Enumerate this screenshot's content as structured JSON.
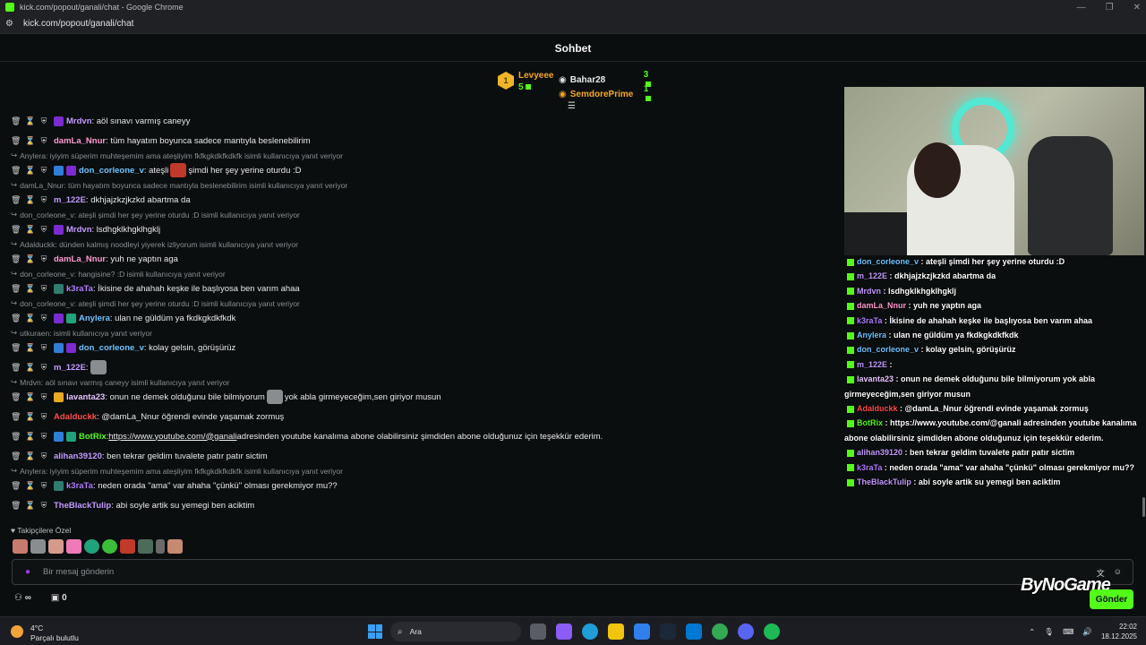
{
  "browser": {
    "window_title": "kick.com/popout/ganali/chat - Google Chrome",
    "url": "kick.com/popout/ganali/chat"
  },
  "chat": {
    "header_title": "Sohbet",
    "leaderboard": {
      "first": {
        "name": "Levyeee",
        "count": "5",
        "rank": "1"
      },
      "rows": [
        {
          "name": "Bahar28",
          "count": "3"
        },
        {
          "name": "SemdorePrime",
          "count": "1"
        }
      ]
    },
    "messages": [
      {
        "reply": "",
        "user": "Mrdvn",
        "color": "#c39bff",
        "badges": [
          "#7b2bd1"
        ],
        "text": ": aöl sınavı varmış caneyy"
      },
      {
        "reply": "",
        "user": "damLa_Nnur",
        "color": "#ff9ad0",
        "badges": [],
        "text": ": tüm hayatım boyunca sadece mantıyla beslenebilirim"
      },
      {
        "reply": "Anylera: iyiyim süperim muhteşemim ama ateşliyim fkfkgkdkfkdkfk isimli kullanıcıya yanıt veriyor",
        "user": "don_corleone_v",
        "color": "#6ec3ff",
        "badges": [
          "#2f7fd8",
          "#7b2bd1"
        ],
        "text": ": ateşli",
        "emote": "#c0392b",
        "after": "şimdi her şey yerine oturdu :D"
      },
      {
        "reply": "damLa_Nnur: tüm hayatım boyunca sadece mantıyla beslenebilirim isimli kullanıcıya yanıt veriyor",
        "user": "m_122E",
        "color": "#c39bff",
        "badges": [],
        "text": ": dkhjajzkzjkzkd abartma da"
      },
      {
        "reply": "don_corleone_v: ateşli şimdi her şey yerine oturdu :D isimli kullanıcıya yanıt veriyor",
        "user": "Mrdvn",
        "color": "#c39bff",
        "badges": [
          "#7b2bd1"
        ],
        "text": ": lsdhgklkhgklhgklj"
      },
      {
        "reply": "Adalduckk: dünden kalmış noodleyi yiyerek izliyorum isimli kullanıcıya yanıt veriyor",
        "user": "damLa_Nnur",
        "color": "#ff9ad0",
        "badges": [],
        "text": ": yuh ne yaptın aga"
      },
      {
        "reply": "don_corleone_v: hangisine? :D isimli kullanıcıya yanıt veriyor",
        "user": "k3raTa",
        "color": "#b07cff",
        "badges": [
          "#2e7d6e"
        ],
        "text": ": İkisine de ahahah keşke ile başlıyosa ben varım ahaa"
      },
      {
        "reply": "don_corleone_v: ateşli şimdi her şey yerine oturdu :D isimli kullanıcıya yanıt veriyor",
        "user": "Anylera",
        "color": "#6ec3ff",
        "badges": [
          "#7b2bd1",
          "#1fa37a"
        ],
        "text": ": ulan ne güldüm ya fkdkgkdkfkdk"
      },
      {
        "reply": "utkuraen: isimli kullanıcıya yanıt veriyor",
        "user": "don_corleone_v",
        "color": "#6ec3ff",
        "badges": [
          "#2f7fd8",
          "#7b2bd1"
        ],
        "text": ": kolay gelsin, görüşürüz"
      },
      {
        "reply": "",
        "user": "m_122E",
        "color": "#c39bff",
        "badges": [],
        "text": ":",
        "emote": "#8a8d90"
      },
      {
        "reply": "Mrdvn: aöl sınavı varmış caneyy isimli kullanıcıya yanıt veriyor",
        "user": "lavanta23",
        "color": "#e7c3ff",
        "badges": [
          "#e8a923"
        ],
        "text": ": onun ne demek olduğunu bile bilmiyorum",
        "emote": "#8a8d90",
        "after": "yok abla girmeyeceğim,sen giriyor musun"
      },
      {
        "reply": "",
        "user": "Adalduckk",
        "color": "#ff4d4d",
        "badges": [],
        "text": ": @damLa_Nnur öğrendi evinde yaşamak zormuş"
      },
      {
        "reply": "",
        "user": "BotRix",
        "color": "#53fc18",
        "badges": [
          "#2f7fd8",
          "#1fa37a"
        ],
        "text": ": ",
        "link": "https://www.youtube.com/@ganali",
        "after": " adresinden youtube kanalıma abone olabilirsiniz şimdiden abone olduğunuz için teşekkür ederim."
      },
      {
        "reply": "",
        "user": "alihan39120",
        "color": "#c39bff",
        "badges": [],
        "text": ": ben tekrar geldim tuvalete patır patır sictim"
      },
      {
        "reply": "Anylera: iyiyim süperim muhteşemim ama ateşliyim fkfkgkdkfkdkfk isimli kullanıcıya yanıt veriyor",
        "user": "k3raTa",
        "color": "#b07cff",
        "badges": [
          "#2e7d6e"
        ],
        "text": ": neden orada \"ama\" var ahaha \"çünkü\" olması gerekmiyor mu??"
      },
      {
        "reply": "",
        "user": "TheBlackTulip",
        "color": "#c39bff",
        "badges": [],
        "text": ": abi soyle artik su yemegi ben aciktim"
      }
    ],
    "followers_label": "Takipçilere Özel",
    "input_placeholder": "Bir mesaj gönderin",
    "bottom_count": "0",
    "send_label": "Gönder"
  },
  "overlay": {
    "brand": "ByNoGame",
    "lines": [
      {
        "user": "don_corleone_v",
        "color": "#6ec3ff",
        "text": " : ateşli  şimdi her şey yerine oturdu :D"
      },
      {
        "user": "m_122E",
        "color": "#c39bff",
        "text": " : dkhjajzkzjkzkd abartma da"
      },
      {
        "user": "Mrdvn",
        "color": "#c39bff",
        "text": " : lsdhgklkhgklhgklj"
      },
      {
        "user": "damLa_Nnur",
        "color": "#ff9ad0",
        "text": " : yuh ne yaptın aga"
      },
      {
        "user": "k3raTa",
        "color": "#b07cff",
        "text": " : İkisine de ahahah keşke ile başlıyosa ben varım ahaa"
      },
      {
        "user": "Anylera",
        "color": "#6ec3ff",
        "text": " : ulan ne güldüm ya fkdkgkdkfkdk"
      },
      {
        "user": "don_corleone_v",
        "color": "#6ec3ff",
        "text": " : kolay gelsin, görüşürüz"
      },
      {
        "user": "m_122E",
        "color": "#c39bff",
        "text": " :"
      },
      {
        "user": "lavanta23",
        "color": "#e7c3ff",
        "text": " : onun ne demek olduğunu bile bilmiyorum  yok abla girmeyeceğim,sen giriyor musun"
      },
      {
        "user": "Adalduckk",
        "color": "#ff4d4d",
        "text": " : @damLa_Nnur öğrendi evinde yaşamak zormuş"
      },
      {
        "user": "BotRix",
        "color": "#53fc18",
        "text": " : https://www.youtube.com/@ganali adresinden youtube kanalıma abone olabilirsiniz şimdiden abone olduğunuz için teşekkür ederim."
      },
      {
        "user": "alihan39120",
        "color": "#c39bff",
        "text": " : ben tekrar geldim tuvalete patır patır sictim"
      },
      {
        "user": "k3raTa",
        "color": "#b07cff",
        "text": " : neden orada \"ama\" var ahaha \"çünkü\" olması gerekmiyor mu??"
      },
      {
        "user": "TheBlackTulip",
        "color": "#c39bff",
        "text": " : abi soyle artik su yemegi ben aciktim"
      }
    ]
  },
  "taskbar": {
    "temperature": "4°C",
    "weather": "Parçalı bulutlu",
    "search": "Ara",
    "time": "22:02",
    "date": "18.12.2025",
    "accent": "#53fc18"
  }
}
